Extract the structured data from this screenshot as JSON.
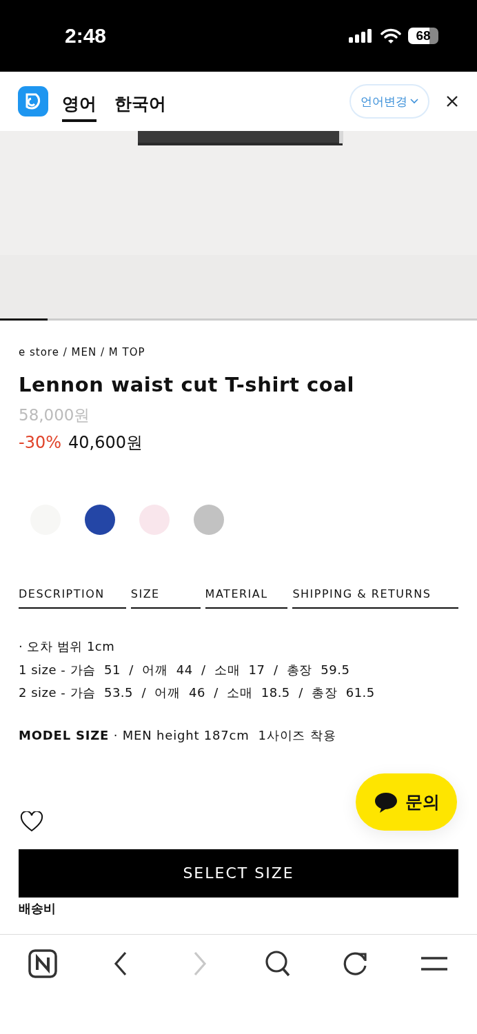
{
  "status_bar": {
    "time": "2:48",
    "battery": "68"
  },
  "translate_bar": {
    "languages": [
      {
        "label": "영어",
        "selected": true
      },
      {
        "label": "한국어",
        "selected": false
      }
    ],
    "change_button": "언어변경"
  },
  "gallery": {
    "kind": "picture",
    "indicator": {
      "level": 0.1
    }
  },
  "breadcrumb": "e store / MEN / M TOP",
  "product": {
    "title": "Lennon waist cut T-shirt coal",
    "original_price": "58,000원",
    "discount": "-30%",
    "sale_price": "40,600원"
  },
  "swatches": [
    {
      "color": "#f7f7f5"
    },
    {
      "color": "#2446a6"
    },
    {
      "color": "#f9e6ec"
    },
    {
      "color": "#c2c2c2"
    }
  ],
  "tabs": [
    {
      "label": "DESCRIPTION"
    },
    {
      "label": "SIZE"
    },
    {
      "label": "MATERIAL"
    },
    {
      "label": "SHIPPING & RETURNS"
    }
  ],
  "size_info": [
    "· 오차 범위 1cm",
    "1 size - 가슴  51  /  어깨  44  /  소매  17  /  총장  59.5",
    "2 size - 가슴  53.5  /  어깨  46  /  소매  18.5  /  총장  61.5"
  ],
  "model_size": "**MODEL SIZE** · MEN height 187cm  1사이즈 착용",
  "chat_button": "문의",
  "select_size_button": "SELECT SIZE",
  "shipping_label": "배송비",
  "browser_toolbar": [
    {
      "kind": "home",
      "disabled": false
    },
    {
      "kind": "back",
      "disabled": false
    },
    {
      "kind": "forward",
      "disabled": true
    },
    {
      "kind": "search",
      "disabled": false
    },
    {
      "kind": "reload",
      "disabled": false
    },
    {
      "kind": "menu",
      "disabled": false
    }
  ]
}
